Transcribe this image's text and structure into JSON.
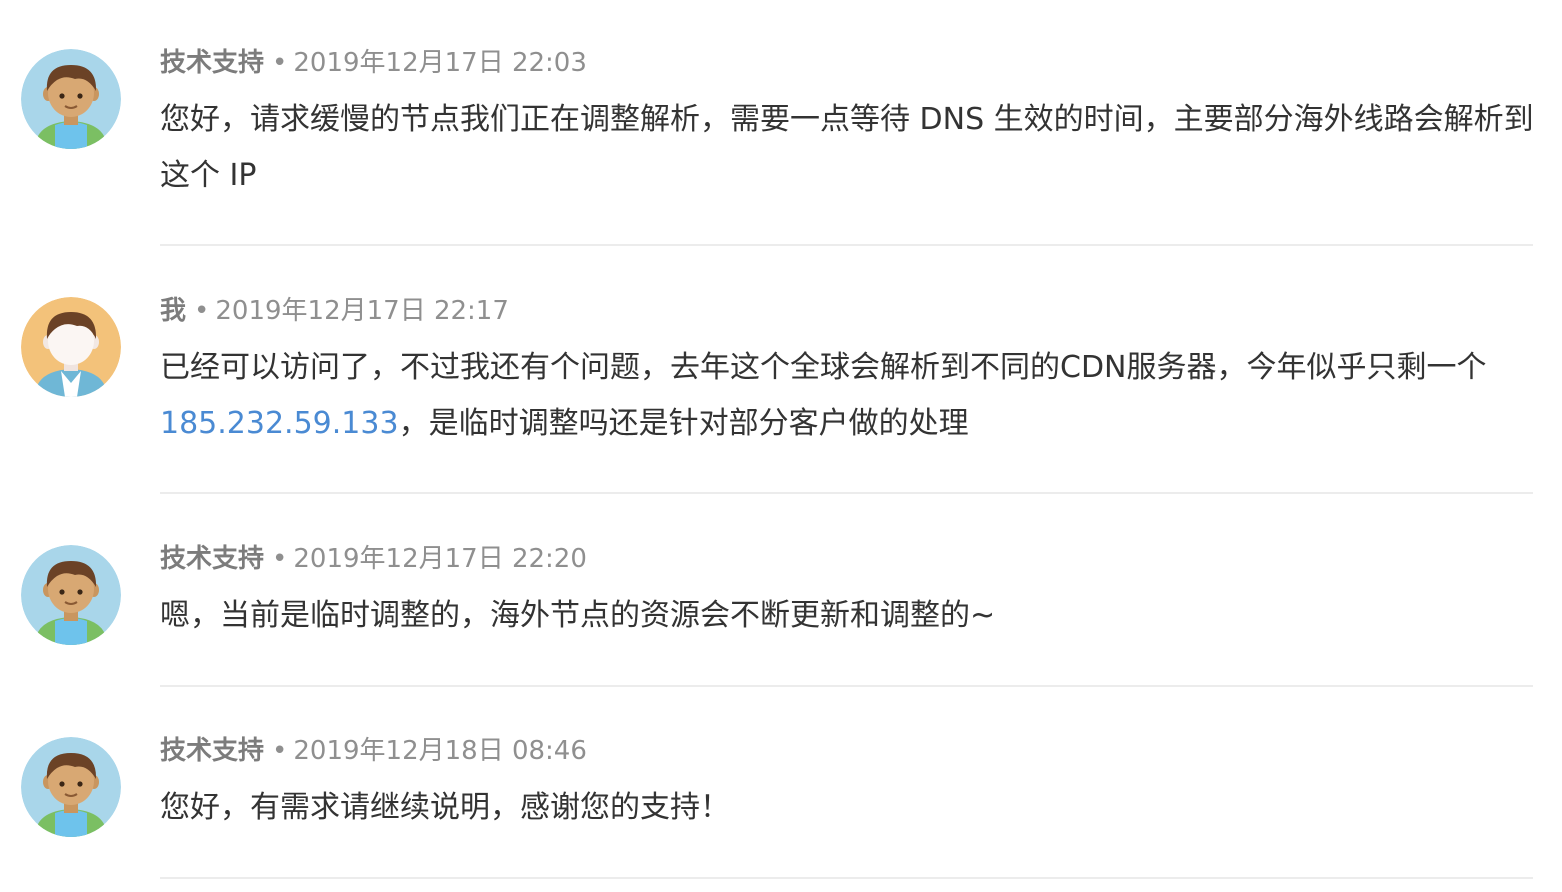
{
  "messages": [
    {
      "author": "技术支持",
      "timestamp": "2019年12月17日 22:03",
      "avatar": "support-avatar-icon",
      "text": "您好，请求缓慢的节点我们正在调整解析，需要一点等待 DNS 生效的时间，主要部分海外线路会解析到这个 IP"
    },
    {
      "author": "我",
      "timestamp": "2019年12月17日 22:17",
      "avatar": "user-avatar-icon",
      "text_before": "已经可以访问了，不过我还有个问题，去年这个全球会解析到不同的CDN服务器，今年似乎只剩一个",
      "link": "185.232.59.133",
      "text_after": "，是临时调整吗还是针对部分客户做的处理"
    },
    {
      "author": "技术支持",
      "timestamp": "2019年12月17日 22:20",
      "avatar": "support-avatar-icon",
      "text": "嗯，当前是临时调整的，海外节点的资源会不断更新和调整的~"
    },
    {
      "author": "技术支持",
      "timestamp": "2019年12月18日 08:46",
      "avatar": "support-avatar-icon",
      "text": "您好，有需求请继续说明，感谢您的支持！"
    }
  ],
  "meta_separator": "•",
  "colors": {
    "link": "#4a8ad3",
    "text": "#333333",
    "meta": "#8f8f8f",
    "divider": "#ececec",
    "support_avatar_bg": "#a9d6ea",
    "user_avatar_bg": "#f3c27a"
  }
}
